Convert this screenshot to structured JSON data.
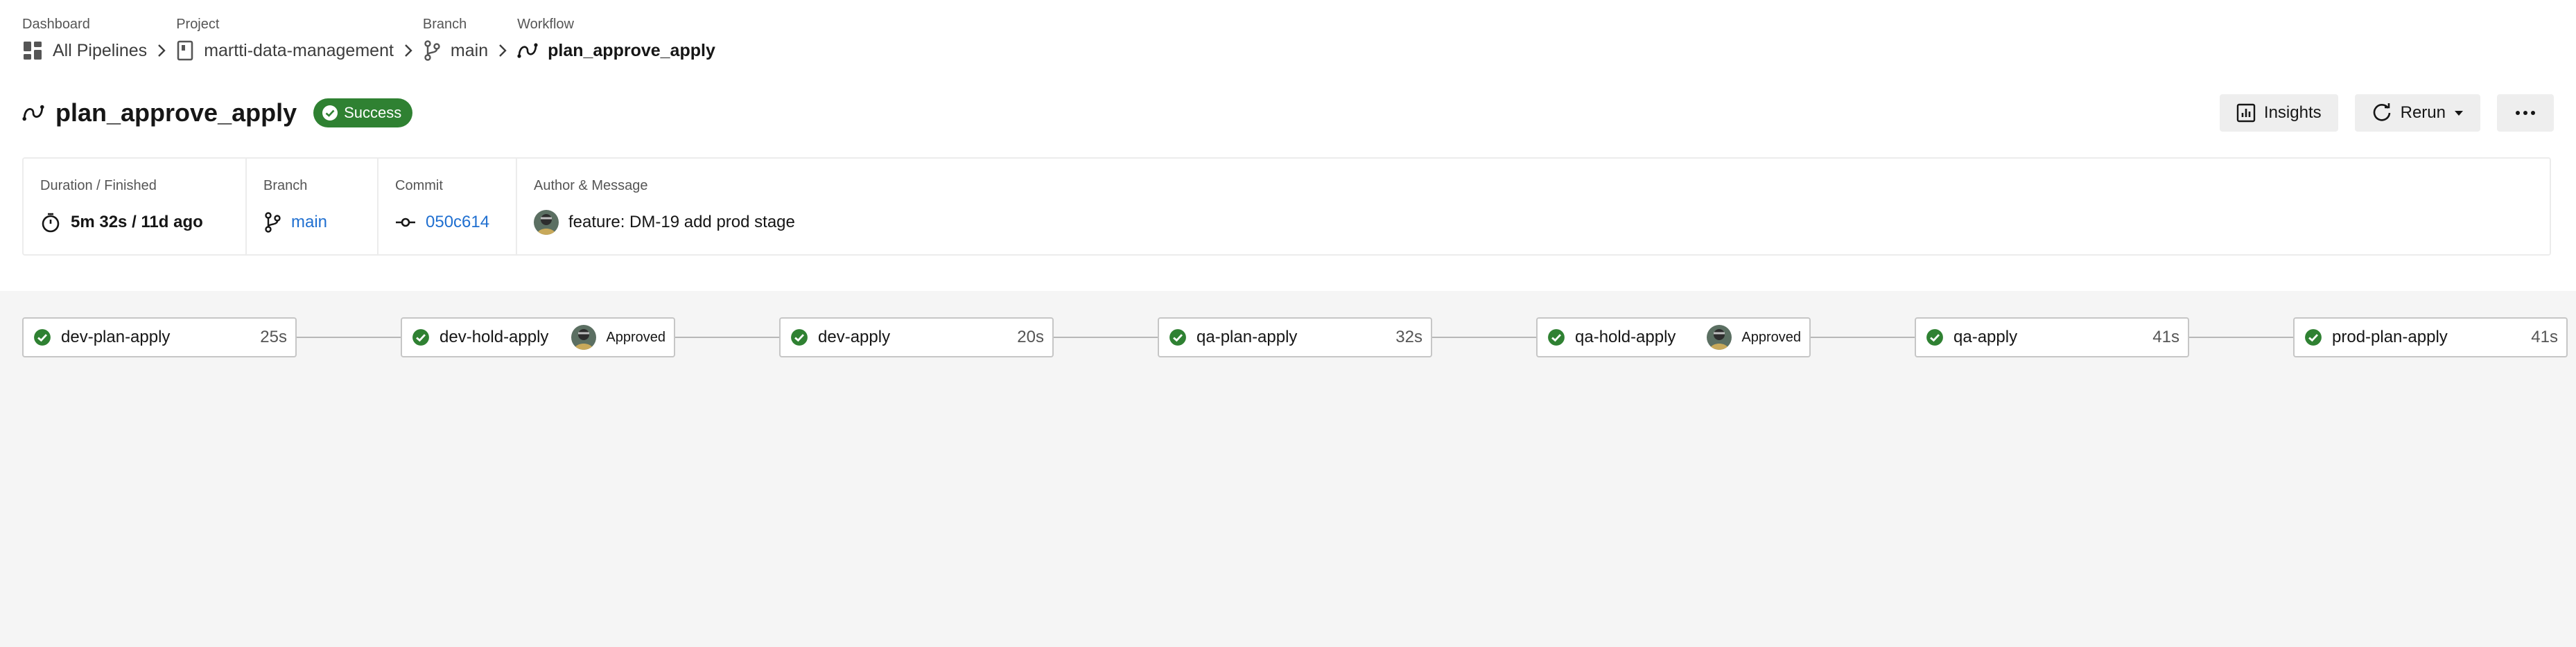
{
  "breadcrumb": [
    {
      "label": "Dashboard",
      "value": "All Pipelines",
      "icon": "dashboard-icon"
    },
    {
      "label": "Project",
      "value": "martti-data-management",
      "icon": "project-icon"
    },
    {
      "label": "Branch",
      "value": "main",
      "icon": "branch-icon"
    },
    {
      "label": "Workflow",
      "value": "plan_approve_apply",
      "icon": "workflow-icon"
    }
  ],
  "header": {
    "title": "plan_approve_apply",
    "status": "Success"
  },
  "actions": {
    "insights": "Insights",
    "rerun": "Rerun",
    "more": "···"
  },
  "info": {
    "duration_label": "Duration / Finished",
    "duration_value": "5m 32s / 11d ago",
    "branch_label": "Branch",
    "branch_value": "main",
    "commit_label": "Commit",
    "commit_value": "050c614",
    "author_label": "Author & Message",
    "author_message": "feature: DM-19 add prod stage"
  },
  "jobs": [
    {
      "name": "dev-plan-apply",
      "duration": "25s"
    },
    {
      "name": "dev-hold-apply",
      "approved": "Approved"
    },
    {
      "name": "dev-apply",
      "duration": "20s"
    },
    {
      "name": "qa-plan-apply",
      "duration": "32s"
    },
    {
      "name": "qa-hold-apply",
      "approved": "Approved"
    },
    {
      "name": "qa-apply",
      "duration": "41s"
    },
    {
      "name": "prod-plan-apply",
      "duration": "41s"
    }
  ],
  "colors": {
    "success": "#2f8132",
    "link": "#1f6fd0"
  }
}
